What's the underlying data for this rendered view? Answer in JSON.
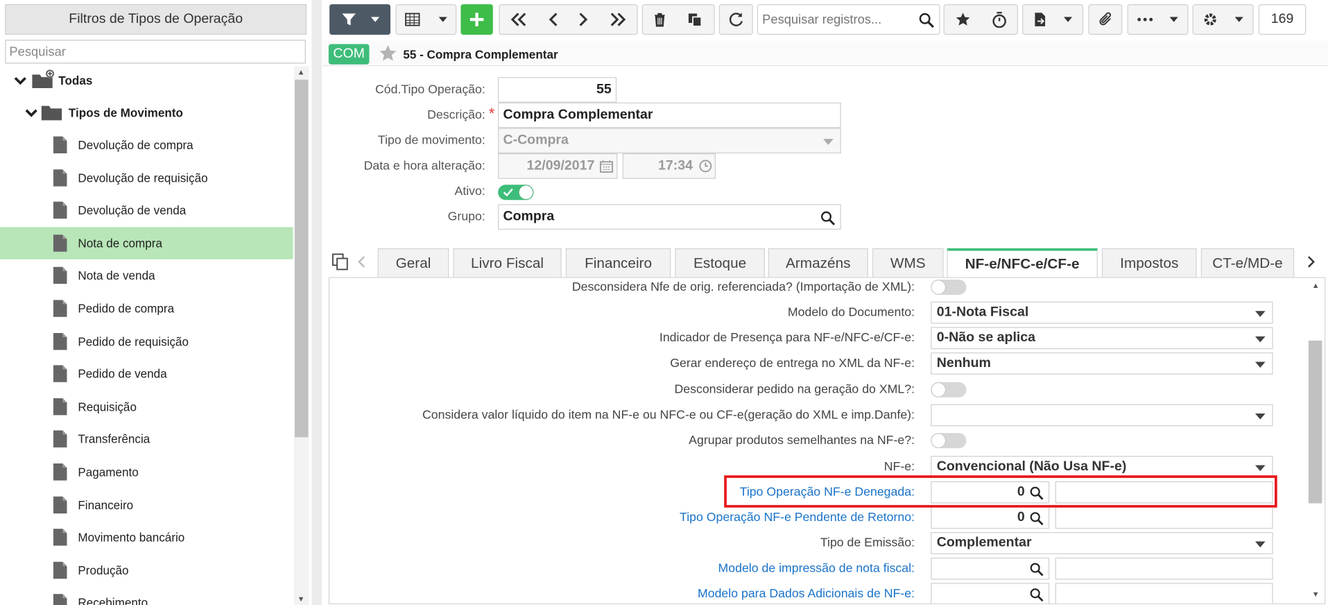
{
  "left_panel": {
    "title": "Filtros de Tipos de Operação",
    "search_placeholder": "Pesquisar",
    "root": "Todas",
    "group": "Tipos de Movimento",
    "items": [
      "Devolução de compra",
      "Devolução de requisição",
      "Devolução de venda",
      "Nota de compra",
      "Nota de venda",
      "Pedido de compra",
      "Pedido de requisição",
      "Pedido de venda",
      "Requisição",
      "Transferência",
      "Pagamento",
      "Financeiro",
      "Movimento bancário",
      "Produção",
      "Recebimento"
    ],
    "selected": "Nota de compra"
  },
  "toolbar": {
    "search_placeholder": "Pesquisar registros...",
    "record_count": "169"
  },
  "header": {
    "badge": "COM",
    "title": "55 - Compra Complementar"
  },
  "form": {
    "cod_label": "Cód.Tipo Operação:",
    "cod_value": "55",
    "descricao_label": "Descrição:",
    "descricao_value": "Compra Complementar",
    "tipo_mov_label": "Tipo de movimento:",
    "tipo_mov_value": "C-Compra",
    "data_label": "Data e hora alteração:",
    "data_value": "12/09/2017",
    "hora_value": "17:34",
    "ativo_label": "Ativo:",
    "grupo_label": "Grupo:",
    "grupo_value": "Compra"
  },
  "tabs": [
    "Geral",
    "Livro Fiscal",
    "Financeiro",
    "Estoque",
    "Armazéns",
    "WMS",
    "NF-e/NFC-e/CF-e",
    "Impostos",
    "CT-e/MD-e"
  ],
  "active_tab": "NF-e/NFC-e/CF-e",
  "nfe": {
    "r1_label": "Desconsidera Nfe de orig. referenciada? (Importação de XML):",
    "r2_label": "Modelo do Documento:",
    "r2_value": "01-Nota Fiscal",
    "r3_label": "Indicador de Presença para NF-e/NFC-e/CF-e:",
    "r3_value": "0-Não se aplica",
    "r4_label": "Gerar endereço de entrega no XML da NF-e:",
    "r4_value": "Nenhum",
    "r5_label": "Desconsiderar pedido na geração do XML?:",
    "r6_label": "Considera valor líquido do item na NF-e ou NFC-e ou CF-e(geração do XML e imp.Danfe):",
    "r6_value": "",
    "r7_label": "Agrupar produtos semelhantes na NF-e?:",
    "r8_label": "NF-e:",
    "r8_value": "Convencional (Não Usa NF-e)",
    "r9_label": "Tipo Operação NF-e Denegada:",
    "r9_value": "0",
    "r10_label": "Tipo Operação NF-e Pendente de Retorno:",
    "r10_value": "0",
    "r11_label": "Tipo de Emissão:",
    "r11_value": "Complementar",
    "r12_label": "Modelo de impressão de nota fiscal:",
    "r13_label": "Modelo para Dados Adicionais de NF-e:"
  }
}
